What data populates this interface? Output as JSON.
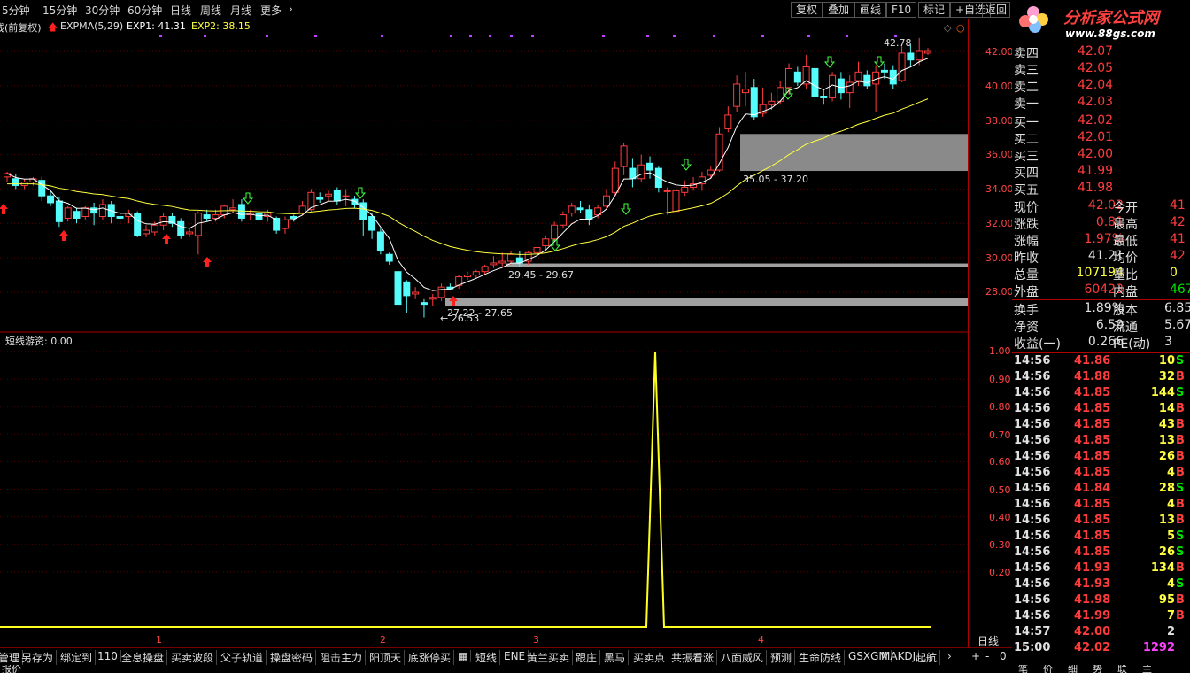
{
  "toolbar": {
    "periods": [
      "5分钟",
      "15分钟",
      "30分钟",
      "60分钟",
      "日线",
      "周线",
      "月线",
      "更多"
    ],
    "more_arrow": "›",
    "right_buttons": [
      "复权",
      "叠加",
      "画线",
      "F10",
      "标记",
      "+自选",
      "返回"
    ]
  },
  "logo": {
    "title": "分析家公式网",
    "url": "www.88gs.com"
  },
  "indicator_header": {
    "fq": "线(前复权)",
    "name": "EXPMA(5,29)",
    "exp1": "EXP1: 41.31",
    "exp2": "EXP2: 38.15"
  },
  "price_axis": [
    "42.00",
    "40.00",
    "38.00",
    "36.00",
    "34.00",
    "32.00",
    "30.00",
    "28.00"
  ],
  "sub_header": "短线游资: 0.00",
  "sub_axis": [
    "1.00",
    "0.90",
    "0.80",
    "0.70",
    "0.60",
    "0.50",
    "0.40",
    "0.30",
    "0.20"
  ],
  "annotations": {
    "high": "42.78",
    "zone1": "35.05 - 37.20",
    "zone2": "29.45 - 29.67",
    "zone3": "27.22 - 27.65",
    "low": "← 26.53"
  },
  "x_labels": [
    "1",
    "2",
    "3",
    "4"
  ],
  "order_book": {
    "sells": [
      {
        "label": "卖四",
        "price": "42.07"
      },
      {
        "label": "卖三",
        "price": "42.05"
      },
      {
        "label": "卖二",
        "price": "42.04"
      },
      {
        "label": "卖一",
        "price": "42.03"
      }
    ],
    "buys": [
      {
        "label": "买一",
        "price": "42.02"
      },
      {
        "label": "买二",
        "price": "42.01"
      },
      {
        "label": "买三",
        "price": "42.00"
      },
      {
        "label": "买四",
        "price": "41.99"
      },
      {
        "label": "买五",
        "price": "41.98"
      }
    ]
  },
  "quote": {
    "rows": [
      {
        "l1": "现价",
        "v1": "42.02",
        "l2": "今开",
        "v2": "41"
      },
      {
        "l1": "涨跌",
        "v1": "0.81",
        "l2": "最高",
        "v2": "42"
      },
      {
        "l1": "涨幅",
        "v1": "1.97%",
        "l2": "最低",
        "v2": "41"
      },
      {
        "l1": "昨收",
        "v1": "41.21",
        "l2": "均价",
        "v2": "42"
      },
      {
        "l1": "总量",
        "v1": "107194",
        "l2": "量比",
        "v2": "0"
      },
      {
        "l1": "外盘",
        "v1": "60423",
        "l2": "内盘",
        "v2": "467"
      }
    ],
    "rows2": [
      {
        "l1": "换手",
        "v1": "1.89%",
        "l2": "股本",
        "v2": "6.85"
      },
      {
        "l1": "净资",
        "v1": "6.50",
        "l2": "流通",
        "v2": "5.67"
      },
      {
        "l1": "收益(一)",
        "v1": "0.266",
        "l2": "PE(动)",
        "v2": "3"
      }
    ]
  },
  "ticks": [
    {
      "t": "14:56",
      "p": "41.86",
      "v": "10",
      "d": "S"
    },
    {
      "t": "14:56",
      "p": "41.88",
      "v": "32",
      "d": "B"
    },
    {
      "t": "14:56",
      "p": "41.85",
      "v": "144",
      "d": "S"
    },
    {
      "t": "14:56",
      "p": "41.85",
      "v": "14",
      "d": "B"
    },
    {
      "t": "14:56",
      "p": "41.85",
      "v": "43",
      "d": "B"
    },
    {
      "t": "14:56",
      "p": "41.85",
      "v": "13",
      "d": "B"
    },
    {
      "t": "14:56",
      "p": "41.85",
      "v": "26",
      "d": "B"
    },
    {
      "t": "14:56",
      "p": "41.85",
      "v": "4",
      "d": "B"
    },
    {
      "t": "14:56",
      "p": "41.84",
      "v": "28",
      "d": "S"
    },
    {
      "t": "14:56",
      "p": "41.85",
      "v": "4",
      "d": "B"
    },
    {
      "t": "14:56",
      "p": "41.85",
      "v": "13",
      "d": "B"
    },
    {
      "t": "14:56",
      "p": "41.85",
      "v": "5",
      "d": "S"
    },
    {
      "t": "14:56",
      "p": "41.85",
      "v": "26",
      "d": "S"
    },
    {
      "t": "14:56",
      "p": "41.93",
      "v": "134",
      "d": "B"
    },
    {
      "t": "14:56",
      "p": "41.93",
      "v": "4",
      "d": "S"
    },
    {
      "t": "14:56",
      "p": "41.98",
      "v": "95",
      "d": "B"
    },
    {
      "t": "14:56",
      "p": "41.99",
      "v": "7",
      "d": "B"
    },
    {
      "t": "14:57",
      "p": "42.00",
      "v": "2",
      "d": ""
    },
    {
      "t": "15:00",
      "p": "42.02",
      "v": "1292",
      "d": ""
    }
  ],
  "bottom_tabs": [
    "管理",
    "另存为",
    "绑定到",
    "110",
    "全息操盘",
    "买卖波段",
    "父子轨道",
    "操盘密码",
    "阻击主力",
    "阳顶天",
    "底涨停买",
    "▦",
    "短线",
    "ENE",
    "黄兰买卖",
    "跟庄",
    "黑马",
    "买卖点",
    "共振看涨",
    "八面威风",
    "预测",
    "生命防线",
    "GSXGM",
    "MAKDJ",
    "起航"
  ],
  "bottom_right": {
    "period": "日线",
    "plus": "+",
    "minus": "-",
    "zero": "0"
  },
  "status": {
    "left": "报价",
    "right": [
      "笔",
      "价",
      "细",
      "势",
      "联",
      "主"
    ]
  },
  "chart_data": {
    "type": "candlestick",
    "ylim": [
      26.5,
      43.5
    ],
    "candles": [
      [
        34.7,
        34.9,
        34.4,
        35.0
      ],
      [
        34.6,
        34.2,
        34.0,
        34.9
      ],
      [
        34.2,
        34.4,
        34.0,
        34.6
      ],
      [
        34.4,
        34.6,
        34.2,
        34.7
      ],
      [
        34.5,
        33.6,
        33.3,
        34.7
      ],
      [
        33.6,
        33.2,
        33.0,
        33.9
      ],
      [
        33.3,
        32.1,
        31.8,
        33.5
      ],
      [
        32.3,
        32.9,
        32.1,
        33.0
      ],
      [
        32.7,
        32.3,
        32.0,
        32.9
      ],
      [
        32.4,
        32.9,
        32.2,
        33.0
      ],
      [
        32.9,
        32.6,
        31.9,
        33.2
      ],
      [
        32.4,
        33.1,
        32.2,
        33.4
      ],
      [
        33.1,
        32.4,
        32.0,
        33.3
      ],
      [
        32.4,
        32.3,
        32.0,
        32.6
      ],
      [
        32.4,
        32.6,
        32.0,
        32.8
      ],
      [
        32.6,
        31.3,
        31.2,
        32.7
      ],
      [
        31.4,
        31.6,
        31.2,
        31.9
      ],
      [
        31.5,
        31.9,
        31.3,
        32.1
      ],
      [
        31.9,
        32.4,
        31.6,
        32.6
      ],
      [
        32.4,
        32.0,
        31.8,
        32.6
      ],
      [
        32.1,
        31.3,
        31.1,
        32.3
      ],
      [
        31.4,
        31.5,
        31.2,
        31.7
      ],
      [
        31.3,
        32.6,
        30.2,
        32.7
      ],
      [
        32.5,
        32.3,
        32.1,
        32.8
      ],
      [
        32.3,
        32.5,
        32.1,
        32.8
      ],
      [
        32.5,
        33.0,
        32.3,
        33.1
      ],
      [
        32.8,
        32.9,
        32.6,
        33.4
      ],
      [
        33.1,
        32.3,
        32.1,
        33.4
      ],
      [
        32.5,
        32.6,
        32.2,
        32.8
      ],
      [
        32.6,
        32.2,
        32.0,
        32.9
      ],
      [
        32.4,
        32.6,
        32.1,
        32.8
      ],
      [
        32.3,
        31.6,
        31.4,
        32.4
      ],
      [
        31.7,
        32.2,
        31.4,
        32.4
      ],
      [
        32.4,
        32.3,
        32.1,
        32.5
      ],
      [
        32.6,
        33.0,
        32.5,
        33.3
      ],
      [
        32.8,
        33.8,
        32.7,
        34.0
      ],
      [
        33.5,
        33.4,
        33.2,
        33.8
      ],
      [
        33.6,
        33.7,
        33.3,
        33.9
      ],
      [
        33.9,
        33.3,
        33.1,
        34.1
      ],
      [
        33.6,
        33.6,
        33.0,
        34.0
      ],
      [
        33.4,
        33.1,
        32.9,
        33.6
      ],
      [
        33.2,
        32.2,
        31.3,
        33.4
      ],
      [
        32.4,
        31.6,
        31.1,
        32.6
      ],
      [
        31.5,
        30.4,
        30.2,
        31.7
      ],
      [
        30.2,
        29.8,
        29.6,
        30.3
      ],
      [
        29.2,
        27.3,
        27.1,
        29.5
      ],
      [
        28.6,
        27.8,
        26.8,
        28.7
      ],
      [
        27.9,
        28.0,
        27.6,
        28.3
      ],
      [
        27.4,
        27.3,
        26.53,
        27.6
      ],
      [
        27.6,
        27.7,
        27.2,
        27.9
      ],
      [
        27.7,
        28.3,
        27.5,
        28.5
      ],
      [
        28.3,
        28.2,
        28.1,
        28.5
      ],
      [
        28.4,
        28.9,
        28.2,
        29.0
      ],
      [
        28.9,
        29.0,
        28.7,
        29.2
      ],
      [
        29.0,
        29.2,
        28.8,
        29.3
      ],
      [
        29.2,
        29.5,
        29.0,
        29.6
      ],
      [
        29.6,
        29.7,
        29.4,
        30.1
      ],
      [
        29.7,
        29.8,
        29.5,
        30.3
      ],
      [
        29.8,
        30.2,
        29.6,
        30.4
      ],
      [
        30.0,
        29.7,
        29.5,
        30.4
      ],
      [
        29.8,
        30.3,
        29.6,
        30.4
      ],
      [
        30.3,
        30.6,
        30.1,
        30.8
      ],
      [
        30.7,
        31.1,
        30.5,
        31.3
      ],
      [
        31.1,
        31.9,
        31.0,
        32.1
      ],
      [
        31.9,
        32.5,
        31.7,
        32.7
      ],
      [
        32.6,
        33.0,
        32.4,
        33.2
      ],
      [
        32.9,
        32.8,
        32.6,
        33.3
      ],
      [
        32.8,
        32.2,
        31.9,
        33.1
      ],
      [
        32.5,
        32.9,
        32.3,
        33.1
      ],
      [
        33.0,
        33.6,
        32.8,
        34.0
      ],
      [
        33.8,
        35.2,
        33.6,
        35.6
      ],
      [
        35.3,
        36.5,
        34.8,
        36.7
      ],
      [
        35.2,
        34.6,
        34.1,
        35.8
      ],
      [
        34.6,
        35.4,
        34.4,
        36.0
      ],
      [
        35.5,
        35.1,
        34.6,
        35.9
      ],
      [
        35.2,
        34.1,
        33.8,
        35.3
      ],
      [
        33.9,
        33.9,
        32.5,
        34.1
      ],
      [
        32.7,
        33.9,
        32.4,
        34.1
      ],
      [
        33.8,
        34.1,
        33.6,
        34.5
      ],
      [
        34.1,
        34.3,
        33.9,
        34.7
      ],
      [
        34.3,
        34.7,
        33.9,
        35.0
      ],
      [
        34.8,
        35.1,
        34.6,
        35.3
      ],
      [
        35.1,
        37.2,
        35.0,
        37.6
      ],
      [
        37.5,
        38.3,
        37.3,
        38.8
      ],
      [
        38.8,
        40.1,
        38.5,
        40.6
      ],
      [
        39.6,
        39.8,
        38.8,
        40.8
      ],
      [
        39.9,
        38.2,
        38.0,
        40.4
      ],
      [
        38.4,
        38.9,
        38.2,
        39.9
      ],
      [
        38.9,
        39.1,
        38.6,
        39.6
      ],
      [
        39.1,
        39.9,
        38.9,
        40.3
      ],
      [
        39.9,
        41.0,
        39.5,
        41.3
      ],
      [
        40.8,
        40.2,
        40.0,
        41.1
      ],
      [
        40.1,
        41.1,
        39.8,
        41.8
      ],
      [
        41.0,
        39.4,
        39.0,
        41.3
      ],
      [
        39.4,
        39.3,
        38.9,
        39.8
      ],
      [
        39.3,
        40.6,
        39.1,
        40.8
      ],
      [
        40.4,
        39.6,
        39.2,
        40.8
      ],
      [
        39.6,
        40.2,
        38.7,
        40.6
      ],
      [
        40.3,
        40.8,
        40.0,
        41.4
      ],
      [
        40.6,
        40.0,
        39.8,
        40.9
      ],
      [
        40.1,
        40.8,
        38.5,
        41.2
      ],
      [
        40.9,
        40.8,
        40.4,
        41.3
      ],
      [
        40.9,
        40.1,
        39.8,
        41.2
      ],
      [
        40.3,
        41.9,
        40.2,
        42.3
      ],
      [
        41.9,
        41.5,
        41.1,
        42.4
      ],
      [
        41.5,
        42.0,
        41.2,
        42.78
      ],
      [
        41.9,
        42.0,
        41.8,
        42.2
      ]
    ]
  }
}
